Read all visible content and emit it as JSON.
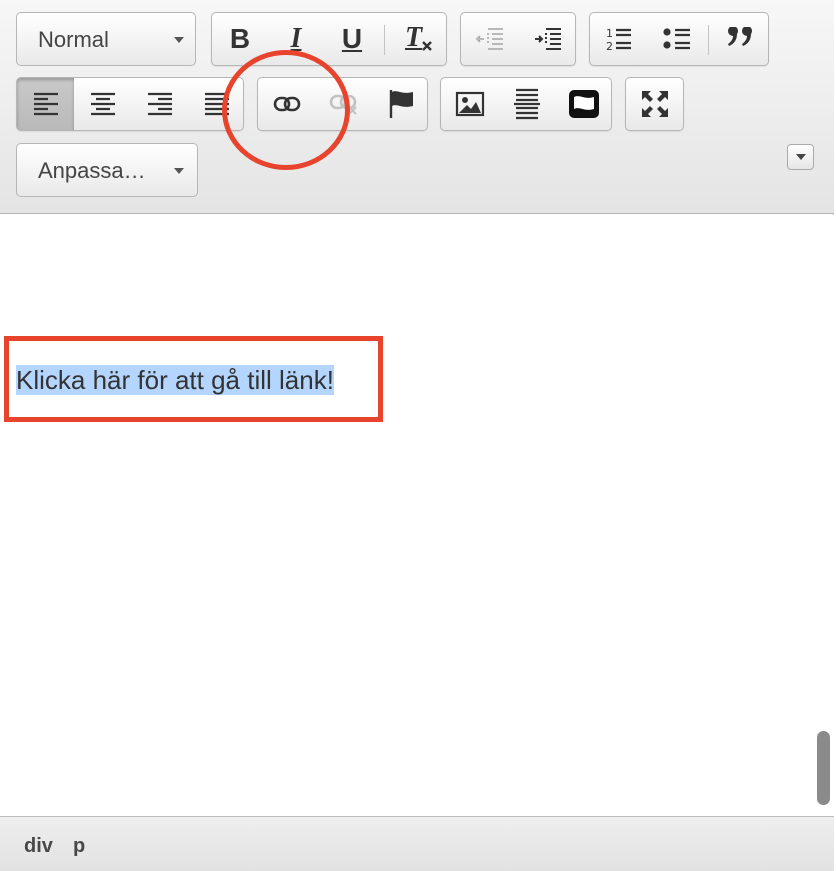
{
  "toolbar": {
    "format_combo": {
      "value": "Normal"
    },
    "styles_combo": {
      "value": "Anpassa…"
    },
    "basic_styles": [
      {
        "name": "bold",
        "glyph": "B"
      },
      {
        "name": "italic",
        "glyph": "I"
      },
      {
        "name": "underline",
        "glyph": "U"
      },
      {
        "name": "remove-format",
        "glyph": "T"
      }
    ],
    "blockquote_glyph": "❞",
    "icons": {
      "outdent": "outdent-icon",
      "indent": "indent-icon",
      "numbered_list": "numbered-list-icon",
      "bulleted_list": "bulleted-list-icon",
      "blockquote": "blockquote-icon",
      "align_left": "align-left-icon",
      "align_center": "align-center-icon",
      "align_right": "align-right-icon",
      "justify": "justify-icon",
      "link": "link-icon",
      "unlink": "unlink-icon",
      "anchor": "anchor-flag-icon",
      "image": "image-icon",
      "horizontal_rule": "horizontal-rule-icon",
      "iframe": "iframe-icon",
      "maximize": "maximize-icon"
    },
    "active_button": "align_left"
  },
  "content": {
    "paragraph_text": "Klicka här för att gå till länk!"
  },
  "annotations": {
    "color": "#e8442d"
  },
  "statusbar": {
    "path": [
      "div",
      "p"
    ]
  }
}
